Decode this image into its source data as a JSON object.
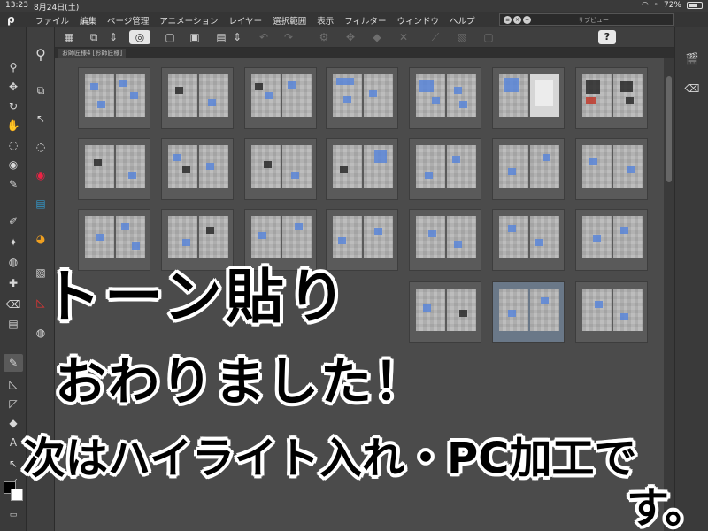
{
  "status": {
    "time": "13:23",
    "date": "8月24日(土)",
    "battery": "72%",
    "battery_level": 0.72
  },
  "menu": {
    "logo": "ρ",
    "items": [
      "ファイル",
      "編集",
      "ページ管理",
      "アニメーション",
      "レイヤー",
      "選択範囲",
      "表示",
      "フィルター",
      "ウィンドウ",
      "ヘルプ"
    ]
  },
  "subview": {
    "title": "サブビュー"
  },
  "commandbar": {
    "help": "?"
  },
  "tab": {
    "label": "お師匠様4 [お師匠様]"
  },
  "icons": {
    "layout": "▦",
    "arrange": "⧉",
    "swirl": "◎",
    "new": "▢",
    "open": "▣",
    "save": "▤",
    "updown": "⇕",
    "undo": "↶",
    "redo": "↷",
    "transform": "✥",
    "gear": "⚙",
    "fill": "◆",
    "grid": "▧",
    "wand": "✕",
    "move": "✥",
    "clapper": "🎬",
    "eraser": "⌫",
    "zoom": "⚲",
    "hand": "✋",
    "rotate": "↻",
    "lasso": "◌",
    "pen": "✎",
    "brush": "✐",
    "airbrush": "✦",
    "blend": "◍",
    "figure": "◺",
    "text": "A",
    "eye": "◉",
    "stamp": "✚",
    "bucket": "◆",
    "gradient": "▤",
    "ruler": "◸",
    "cursor": "↖",
    "line": "⟋"
  },
  "colors": {
    "ui_dark": "#3a3a3a",
    "canvas": "#4b4b4b",
    "tone_blue": "#5a86d8",
    "main_color": "#000000",
    "sub_color": "#ffffff"
  },
  "overlay": {
    "line1": "トーン貼り",
    "line2": "おわりました！",
    "line3": "次はハイライト入れ・PC加工で",
    "line4": "す。"
  }
}
